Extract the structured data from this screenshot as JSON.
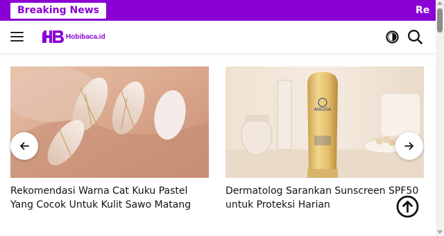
{
  "ticker": {
    "label": "Breaking News",
    "text": "Re"
  },
  "header": {
    "logo_text": "Hobibaca.id",
    "menu_icon": "hamburger-icon",
    "theme_icon": "dark-mode-toggle-icon",
    "search_icon": "search-icon"
  },
  "colors": {
    "brand": "#8a00d4",
    "text": "#111111",
    "background": "#ffffff"
  },
  "carousel": {
    "prev_icon": "arrow-left-icon",
    "next_icon": "arrow-right-icon",
    "items": [
      {
        "title": "Rekomendasi Warna Cat Kuku Pastel Yang Cocok Untuk Kulit Sawo Matang",
        "image": "nails-photo"
      },
      {
        "title": "Dermatolog Sarankan Sunscreen SPF50 untuk Proteksi Harian",
        "image": "sunscreen-photo",
        "product_text": "ANESSA"
      }
    ]
  },
  "back_to_top_icon": "arrow-up-circle-icon"
}
